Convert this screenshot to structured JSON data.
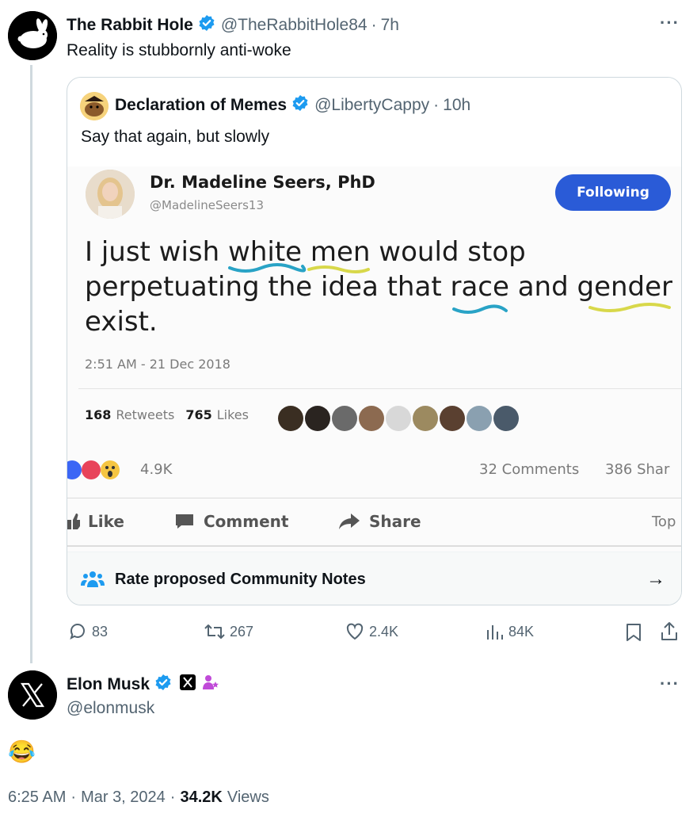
{
  "post": {
    "author_name": "The Rabbit Hole",
    "author_handle": "@TheRabbitHole84",
    "separator": "·",
    "time_ago": "7h",
    "text": "Reality is stubbornly anti-woke",
    "more_label": "···"
  },
  "quote": {
    "author_name": "Declaration of Memes",
    "author_handle": "@LibertyCappy",
    "separator": "·",
    "time_ago": "10h",
    "text": "Say that again, but slowly",
    "image": {
      "profile_name": "Dr. Madeline Seers, PhD",
      "profile_handle": "@MadelineSeers13",
      "follow_label": "Following",
      "tweet_line1_a": "I just wish ",
      "tweet_line1_white": "white",
      "tweet_line1_sp": " ",
      "tweet_line1_men": "men",
      "tweet_line1_b": " would stop",
      "tweet_line2_a": "perpetuating the idea that ",
      "tweet_line2_race": "race",
      "tweet_line2_b": " and ",
      "tweet_line2_gender": "gender",
      "tweet_line3": "exist.",
      "timestamp": "2:51 AM - 21 Dec 2018",
      "retweets_count": "168",
      "retweets_label": "Retweets",
      "likes_count": "765",
      "likes_label": "Likes",
      "reactions_count": "4.9K",
      "comments_label": "32 Comments",
      "shares_label": "386 Shar",
      "like_button": "Like",
      "comment_button": "Comment",
      "share_button": "Share",
      "top_label": "Top"
    },
    "community_notes_label": "Rate proposed Community Notes",
    "arrow": "→"
  },
  "actions": {
    "replies": "83",
    "reposts": "267",
    "likes": "2.4K",
    "views": "84K"
  },
  "reply": {
    "author_name": "Elon Musk",
    "author_handle": "@elonmusk",
    "emoji": "😂",
    "more_label": "···",
    "time": "6:25 AM",
    "separator": "·",
    "date": "Mar 3, 2024",
    "separator2": "·",
    "views_count": "34.2K",
    "views_label": "Views"
  },
  "colors": {
    "verified_blue": "#1d9bf0",
    "follow_blue": "#2a5bd7",
    "underline_teal": "#29a3c6",
    "underline_yellow": "#d8d84a",
    "thread_line": "#cfd9de"
  }
}
